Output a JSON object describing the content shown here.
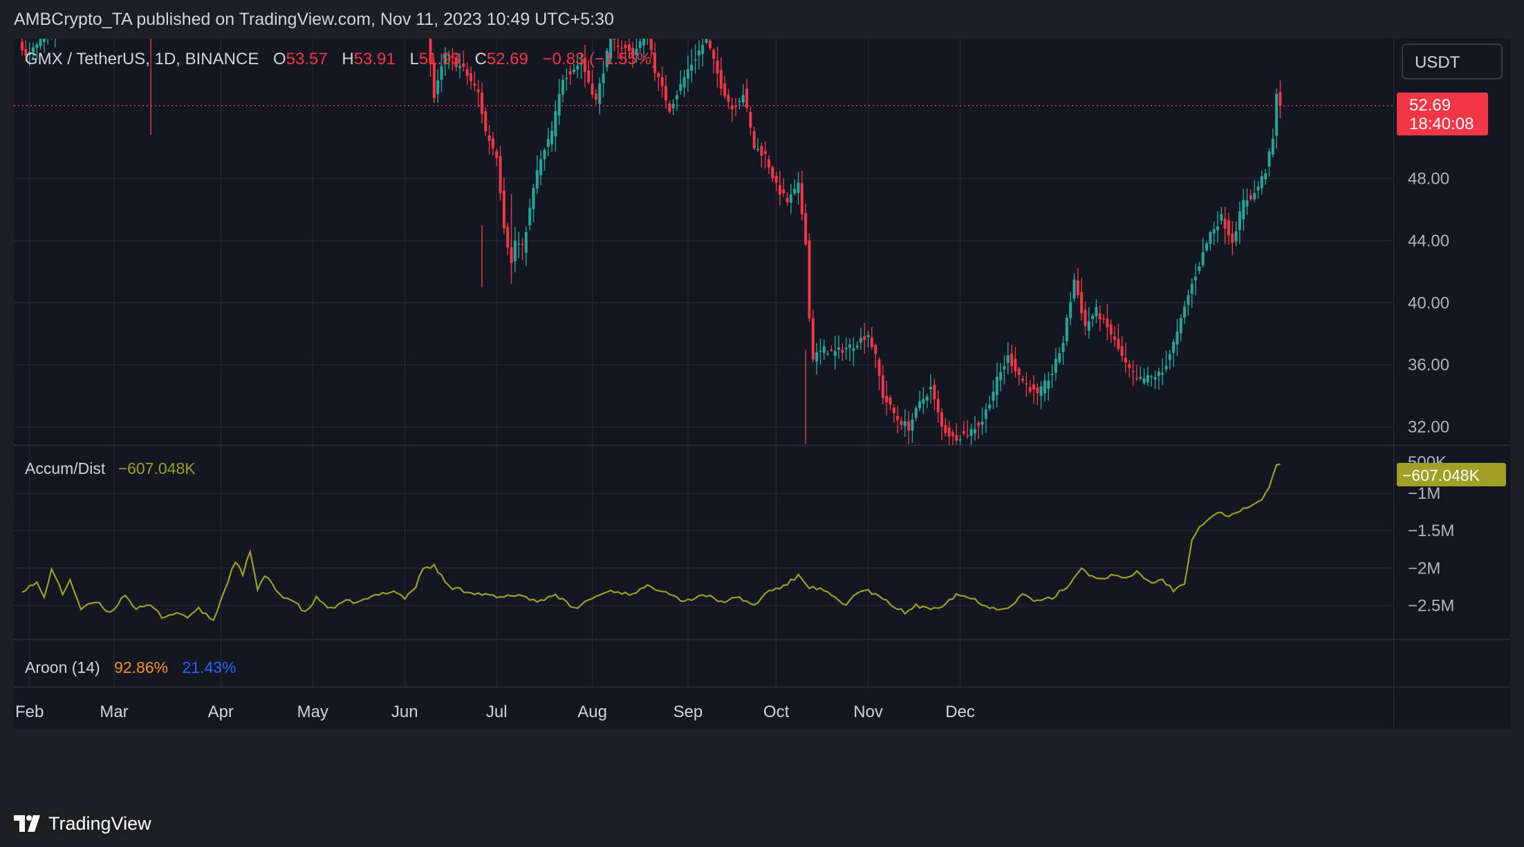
{
  "header": {
    "publisher_line": "AMBCrypto_TA published on TradingView.com, Nov 11, 2023 10:49 UTC+5:30"
  },
  "footer": {
    "brand": "TradingView",
    "logo_icon": "tradingview-logo-icon"
  },
  "colors": {
    "up": "#26a69a",
    "down": "#f23645",
    "accum": "#9fa023",
    "aroon_up": "#f7931a",
    "aroon_down": "#2962ff",
    "bg": "#131722"
  },
  "chart_data": [
    {
      "type": "candlestick",
      "legend": {
        "symbol": "GMX / TetherUS, 1D, BINANCE",
        "open_label": "O",
        "open": "53.57",
        "high_label": "H",
        "high": "53.91",
        "low_label": "L",
        "low": "51.93",
        "close_label": "C",
        "close": "52.69",
        "change": "−0.83 (−1.55%)"
      },
      "currency": "USDT",
      "last_price": "52.69",
      "countdown": "18:40:08",
      "y_ticks": [
        "48.00",
        "44.00",
        "40.00",
        "36.00",
        "32.00"
      ],
      "ylim": [
        30.85,
        57.0
      ],
      "x_ticks": [
        "Feb",
        "Mar",
        "Apr",
        "May",
        "Jun",
        "Jul",
        "Aug",
        "Sep",
        "Oct",
        "Nov",
        "Dec"
      ],
      "waypoints": [
        {
          "d": 0,
          "p": 56.5
        },
        {
          "d": 1,
          "p": 55.8
        },
        {
          "d": 10,
          "p": 58
        },
        {
          "d": 45,
          "p": 60
        },
        {
          "d": 110,
          "p": 59
        },
        {
          "d": 111,
          "p": 55.5
        },
        {
          "d": 112,
          "p": 53.2
        },
        {
          "d": 115,
          "p": 56
        },
        {
          "d": 120,
          "p": 55
        },
        {
          "d": 124,
          "p": 53.5
        },
        {
          "d": 126,
          "p": 51
        },
        {
          "d": 129,
          "p": 49.5
        },
        {
          "d": 131,
          "p": 45
        },
        {
          "d": 133,
          "p": 42.5
        },
        {
          "d": 134,
          "p": 44
        },
        {
          "d": 136,
          "p": 43.5
        },
        {
          "d": 140,
          "p": 48.5
        },
        {
          "d": 144,
          "p": 51
        },
        {
          "d": 147,
          "p": 54.5
        },
        {
          "d": 152,
          "p": 55.5
        },
        {
          "d": 156,
          "p": 53
        },
        {
          "d": 160,
          "p": 57
        },
        {
          "d": 166,
          "p": 56
        },
        {
          "d": 170,
          "p": 57.5
        },
        {
          "d": 172,
          "p": 55
        },
        {
          "d": 176,
          "p": 52.5
        },
        {
          "d": 181,
          "p": 55
        },
        {
          "d": 186,
          "p": 57
        },
        {
          "d": 190,
          "p": 54
        },
        {
          "d": 193,
          "p": 52.5
        },
        {
          "d": 196,
          "p": 53.5
        },
        {
          "d": 199,
          "p": 50
        },
        {
          "d": 202,
          "p": 49.5
        },
        {
          "d": 205,
          "p": 47.5
        },
        {
          "d": 208,
          "p": 46.5
        },
        {
          "d": 211,
          "p": 47.5
        },
        {
          "d": 213,
          "p": 44
        },
        {
          "d": 214,
          "p": 39
        },
        {
          "d": 215,
          "p": 36.5
        },
        {
          "d": 218,
          "p": 37
        },
        {
          "d": 221,
          "p": 36.8
        },
        {
          "d": 226,
          "p": 37.3
        },
        {
          "d": 230,
          "p": 38
        },
        {
          "d": 232,
          "p": 36.5
        },
        {
          "d": 234,
          "p": 34
        },
        {
          "d": 238,
          "p": 32.5
        },
        {
          "d": 241,
          "p": 32
        },
        {
          "d": 244,
          "p": 33.5
        },
        {
          "d": 247,
          "p": 34.5
        },
        {
          "d": 250,
          "p": 32
        },
        {
          "d": 253,
          "p": 31.3
        },
        {
          "d": 257,
          "p": 31.6
        },
        {
          "d": 261,
          "p": 32.4
        },
        {
          "d": 265,
          "p": 35
        },
        {
          "d": 268,
          "p": 36.5
        },
        {
          "d": 272,
          "p": 35
        },
        {
          "d": 276,
          "p": 34
        },
        {
          "d": 280,
          "p": 35.5
        },
        {
          "d": 283,
          "p": 37.5
        },
        {
          "d": 286,
          "p": 41.5
        },
        {
          "d": 289,
          "p": 38.5
        },
        {
          "d": 292,
          "p": 39.5
        },
        {
          "d": 296,
          "p": 38
        },
        {
          "d": 300,
          "p": 36
        },
        {
          "d": 303,
          "p": 35
        },
        {
          "d": 307,
          "p": 35.2
        },
        {
          "d": 310,
          "p": 35.5
        },
        {
          "d": 314,
          "p": 38
        },
        {
          "d": 317,
          "p": 40.5
        },
        {
          "d": 320,
          "p": 42.5
        },
        {
          "d": 323,
          "p": 44.5
        },
        {
          "d": 326,
          "p": 45.5
        },
        {
          "d": 329,
          "p": 44
        },
        {
          "d": 332,
          "p": 46.5
        },
        {
          "d": 335,
          "p": 47
        },
        {
          "d": 338,
          "p": 48.5
        },
        {
          "d": 340,
          "p": 50.5
        },
        {
          "d": 341,
          "p": 53.3
        },
        {
          "d": 342,
          "p": 52.7
        }
      ]
    },
    {
      "type": "line",
      "indicator": "Accum/Dist",
      "value": "−607.048K",
      "y_ticks": [
        "500K",
        "−1M",
        "−1.5M",
        "−2M",
        "−2.5M"
      ],
      "ylim": [
        -2.95,
        -0.36
      ],
      "series": [
        {
          "name": "Accum/Dist",
          "waypoints": [
            {
              "d": 0,
              "v": -2.3
            },
            {
              "d": 4,
              "v": -2.2
            },
            {
              "d": 6,
              "v": -2.4
            },
            {
              "d": 8,
              "v": -2.0
            },
            {
              "d": 11,
              "v": -2.35
            },
            {
              "d": 13,
              "v": -2.15
            },
            {
              "d": 16,
              "v": -2.55
            },
            {
              "d": 20,
              "v": -2.45
            },
            {
              "d": 24,
              "v": -2.6
            },
            {
              "d": 28,
              "v": -2.35
            },
            {
              "d": 31,
              "v": -2.55
            },
            {
              "d": 35,
              "v": -2.5
            },
            {
              "d": 38,
              "v": -2.65
            },
            {
              "d": 42,
              "v": -2.6
            },
            {
              "d": 45,
              "v": -2.65
            },
            {
              "d": 48,
              "v": -2.55
            },
            {
              "d": 52,
              "v": -2.7
            },
            {
              "d": 55,
              "v": -2.3
            },
            {
              "d": 58,
              "v": -1.9
            },
            {
              "d": 60,
              "v": -2.1
            },
            {
              "d": 62,
              "v": -1.76
            },
            {
              "d": 64,
              "v": -2.3
            },
            {
              "d": 66,
              "v": -2.1
            },
            {
              "d": 70,
              "v": -2.35
            },
            {
              "d": 74,
              "v": -2.45
            },
            {
              "d": 77,
              "v": -2.6
            },
            {
              "d": 80,
              "v": -2.4
            },
            {
              "d": 84,
              "v": -2.55
            },
            {
              "d": 88,
              "v": -2.45
            },
            {
              "d": 92,
              "v": -2.45
            },
            {
              "d": 97,
              "v": -2.35
            },
            {
              "d": 101,
              "v": -2.3
            },
            {
              "d": 104,
              "v": -2.4
            },
            {
              "d": 107,
              "v": -2.25
            },
            {
              "d": 109,
              "v": -2.0
            },
            {
              "d": 112,
              "v": -1.97
            },
            {
              "d": 116,
              "v": -2.25
            },
            {
              "d": 120,
              "v": -2.3
            },
            {
              "d": 125,
              "v": -2.35
            },
            {
              "d": 130,
              "v": -2.4
            },
            {
              "d": 135,
              "v": -2.35
            },
            {
              "d": 140,
              "v": -2.45
            },
            {
              "d": 145,
              "v": -2.35
            },
            {
              "d": 150,
              "v": -2.55
            },
            {
              "d": 155,
              "v": -2.4
            },
            {
              "d": 160,
              "v": -2.3
            },
            {
              "d": 165,
              "v": -2.35
            },
            {
              "d": 170,
              "v": -2.25
            },
            {
              "d": 175,
              "v": -2.3
            },
            {
              "d": 180,
              "v": -2.45
            },
            {
              "d": 185,
              "v": -2.35
            },
            {
              "d": 190,
              "v": -2.45
            },
            {
              "d": 195,
              "v": -2.4
            },
            {
              "d": 199,
              "v": -2.5
            },
            {
              "d": 203,
              "v": -2.3
            },
            {
              "d": 207,
              "v": -2.25
            },
            {
              "d": 211,
              "v": -2.1
            },
            {
              "d": 214,
              "v": -2.25
            },
            {
              "d": 218,
              "v": -2.3
            },
            {
              "d": 222,
              "v": -2.45
            },
            {
              "d": 224,
              "v": -2.5
            },
            {
              "d": 226,
              "v": -2.35
            },
            {
              "d": 230,
              "v": -2.3
            },
            {
              "d": 235,
              "v": -2.45
            },
            {
              "d": 240,
              "v": -2.6
            },
            {
              "d": 243,
              "v": -2.5
            },
            {
              "d": 246,
              "v": -2.55
            },
            {
              "d": 250,
              "v": -2.5
            },
            {
              "d": 254,
              "v": -2.35
            },
            {
              "d": 258,
              "v": -2.4
            },
            {
              "d": 262,
              "v": -2.5
            },
            {
              "d": 265,
              "v": -2.55
            },
            {
              "d": 269,
              "v": -2.5
            },
            {
              "d": 272,
              "v": -2.35
            },
            {
              "d": 276,
              "v": -2.45
            },
            {
              "d": 280,
              "v": -2.4
            },
            {
              "d": 284,
              "v": -2.25
            },
            {
              "d": 288,
              "v": -2.0
            },
            {
              "d": 292,
              "v": -2.15
            },
            {
              "d": 296,
              "v": -2.1
            },
            {
              "d": 300,
              "v": -2.15
            },
            {
              "d": 303,
              "v": -2.05
            },
            {
              "d": 307,
              "v": -2.2
            },
            {
              "d": 310,
              "v": -2.15
            },
            {
              "d": 313,
              "v": -2.3
            },
            {
              "d": 316,
              "v": -2.2
            },
            {
              "d": 318,
              "v": -1.6
            },
            {
              "d": 320,
              "v": -1.45
            },
            {
              "d": 322,
              "v": -1.35
            },
            {
              "d": 325,
              "v": -1.25
            },
            {
              "d": 328,
              "v": -1.3
            },
            {
              "d": 331,
              "v": -1.25
            },
            {
              "d": 334,
              "v": -1.15
            },
            {
              "d": 337,
              "v": -1.1
            },
            {
              "d": 339,
              "v": -0.9
            },
            {
              "d": 341,
              "v": -0.62
            },
            {
              "d": 342,
              "v": -0.607
            }
          ]
        }
      ]
    },
    {
      "type": "indicator",
      "indicator": "Aroon (14)",
      "up": "92.86%",
      "down": "21.43%"
    }
  ]
}
